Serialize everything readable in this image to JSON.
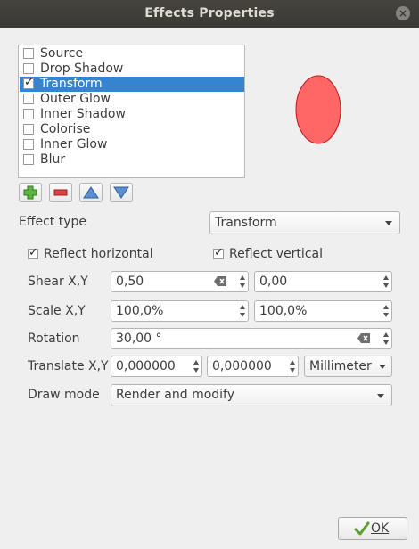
{
  "window": {
    "title": "Effects Properties"
  },
  "effects": [
    {
      "label": "Source",
      "checked": false,
      "selected": false
    },
    {
      "label": "Drop Shadow",
      "checked": false,
      "selected": false
    },
    {
      "label": "Transform",
      "checked": true,
      "selected": true
    },
    {
      "label": "Outer Glow",
      "checked": false,
      "selected": false
    },
    {
      "label": "Inner Shadow",
      "checked": false,
      "selected": false
    },
    {
      "label": "Colorise",
      "checked": false,
      "selected": false
    },
    {
      "label": "Inner Glow",
      "checked": false,
      "selected": false
    },
    {
      "label": "Blur",
      "checked": false,
      "selected": false
    }
  ],
  "toolbar": {
    "add": "add-effect",
    "remove": "remove-effect",
    "up": "move-up",
    "down": "move-down"
  },
  "effect_type": {
    "label": "Effect type",
    "value": "Transform"
  },
  "reflect": {
    "horizontal_label": "Reflect horizontal",
    "vertical_label": "Reflect vertical",
    "horizontal": true,
    "vertical": true
  },
  "shear": {
    "label": "Shear X,Y",
    "x": "0,50",
    "y": "0,00"
  },
  "scale": {
    "label": "Scale X,Y",
    "x": "100,0%",
    "y": "100,0%"
  },
  "rotation": {
    "label": "Rotation",
    "value": "30,00 °"
  },
  "translate": {
    "label": "Translate X,Y",
    "x": "0,000000",
    "y": "0,000000",
    "unit": "Millimeter"
  },
  "draw_mode": {
    "label": "Draw mode",
    "value": "Render and modify"
  },
  "buttons": {
    "ok": "OK"
  },
  "colors": {
    "selection": "#3584d0",
    "preview_fill": "#ff6666",
    "preview_stroke": "#c0151a"
  }
}
